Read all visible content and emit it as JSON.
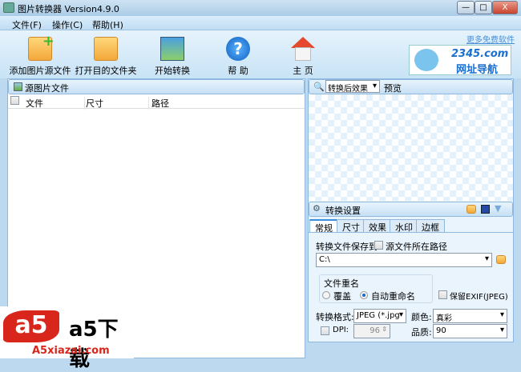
{
  "window": {
    "title": "图片转换器 Version4.9.0",
    "minimize": "—",
    "maximize": "□",
    "close": "X"
  },
  "menu": [
    "文件(F)",
    "操作(C)",
    "帮助(H)"
  ],
  "toolbar": [
    {
      "label": "添加图片源文件",
      "icon": "add-folder-icon"
    },
    {
      "label": "打开目的文件夹",
      "icon": "folder-icon"
    },
    {
      "label": "开始转换",
      "icon": "magic-wand-icon"
    },
    {
      "label": "帮 助",
      "icon": "help-icon"
    },
    {
      "label": "主 页",
      "icon": "home-icon"
    }
  ],
  "more_link": "更多免费软件",
  "ad": {
    "brand": "2345.com",
    "sub": "网址导航"
  },
  "source_panel": {
    "title": "源图片文件",
    "columns": [
      "文件",
      "尺寸",
      "路径"
    ]
  },
  "preview": {
    "mode": "转换后效果",
    "label": "预览"
  },
  "settings": {
    "title": "转换设置",
    "tabs": [
      "常规",
      "尺寸",
      "效果",
      "水印",
      "边框"
    ],
    "active_tab": "常规",
    "save_to_label": "转换文件保存到:",
    "source_path_label": "源文件所在路径",
    "path": "C:\\",
    "rename_group": "文件重名",
    "overwrite": "覆盖",
    "auto_rename": "自动重命名",
    "keep_exif": "保留EXIF(JPEG)",
    "format_label": "转换格式:",
    "format": "JPEG (*.jpg",
    "color_label": "颜色:",
    "color": "真彩",
    "dpi_label": "DPI:",
    "dpi": "96",
    "quality_label": "品质:",
    "quality": "90"
  },
  "watermark": {
    "logo": "a5下载",
    "site": "A5xiazai.com"
  }
}
